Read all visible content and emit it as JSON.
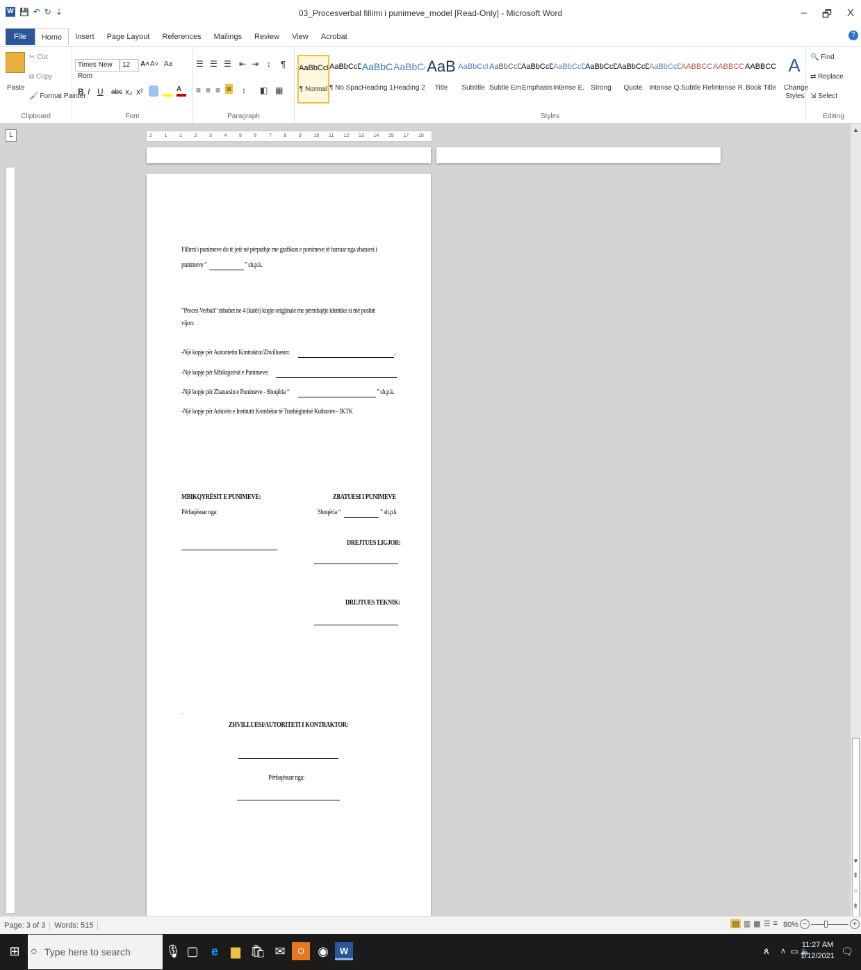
{
  "window": {
    "title": "03_Procesverbal fillimi i punimeve_model [Read-Only] - Microsoft Word",
    "minimize": "–",
    "restore": "🗗",
    "close": "X"
  },
  "qat": {
    "word_icon": "W",
    "save_icon": "💾",
    "undo_icon": "↶",
    "redo_icon": "↻",
    "customize": "⇣"
  },
  "tabs": [
    "File",
    "Home",
    "Insert",
    "Page Layout",
    "References",
    "Mailings",
    "Review",
    "View",
    "Acrobat"
  ],
  "ribbon": {
    "clipboard": {
      "paste": "Paste",
      "cut": "Cut",
      "copy": "Copy",
      "format_painter": "Format Painter",
      "label": "Clipboard"
    },
    "font": {
      "name": "Times New Rom",
      "size": "12",
      "label": "Font",
      "bold": "B",
      "italic": "I",
      "underline": "U",
      "strike": "abc",
      "sub": "x₂",
      "sup": "x²",
      "grow": "A˄",
      "shrink": "A˅",
      "case": "Aa"
    },
    "paragraph": {
      "label": "Paragraph",
      "pilcrow": "¶"
    },
    "styles": {
      "label": "Styles",
      "items": [
        {
          "sample": "AaBbCcDc",
          "name": "¶ Normal",
          "color": "#000000"
        },
        {
          "sample": "AaBbCcDc",
          "name": "¶ No Spaci...",
          "color": "#000000"
        },
        {
          "sample": "AaBbC",
          "name": "Heading 1",
          "color": "#2e74b5"
        },
        {
          "sample": "AaBbCc",
          "name": "Heading 2",
          "color": "#4f81bd"
        },
        {
          "sample": "AaB",
          "name": "Title",
          "color": "#17365d"
        },
        {
          "sample": "AaBbCcI",
          "name": "Subtitle",
          "color": "#4f81bd"
        },
        {
          "sample": "AaBbCcDc",
          "name": "Subtle Em...",
          "color": "#555555"
        },
        {
          "sample": "AaBbCcDc",
          "name": "Emphasis",
          "color": "#000000"
        },
        {
          "sample": "AaBbCcDc",
          "name": "Intense E...",
          "color": "#4f81bd"
        },
        {
          "sample": "AaBbCcDc",
          "name": "Strong",
          "color": "#000000"
        },
        {
          "sample": "AaBbCcDc",
          "name": "Quote",
          "color": "#000000"
        },
        {
          "sample": "AaBbCcDc",
          "name": "Intense Q...",
          "color": "#4f81bd"
        },
        {
          "sample": "AABBCCDC",
          "name": "Subtle Ref...",
          "color": "#c0504d"
        },
        {
          "sample": "AABBCCDC",
          "name": "Intense R...",
          "color": "#c0504d"
        },
        {
          "sample": "AABBCCDC",
          "name": "Book Title",
          "color": "#000000"
        }
      ],
      "change_styles": "Change Styles"
    },
    "editing": {
      "find": "Find",
      "replace": "Replace",
      "select": "Select",
      "label": "Editing"
    }
  },
  "document": {
    "para1_line1": "Fillimi i punimeve do të jetë në përputhje me grafikun e punimeve të hartuar nga zbatuesi i",
    "para1_line2_a": "punimeve “",
    "para1_line2_b": "” sh.p.k.",
    "para2_line1": "“Proces Verbali” mbahet ne 4 (katër) kopje origjinale me përmbajtje identike si më poshtë",
    "para2_line2": "vijon:",
    "copy1": "-Një kopje për Autoritetin Kontraktor/Zhvilluesin:",
    "copy1_end": ",",
    "copy2": "-Një kopje për Mbikqyrësit e Punimeve:",
    "copy3": "-Një kopje për Zbatuesin e Punimeve - Shoqëria “",
    "copy3_end": "” sh.p.k.",
    "copy4": "-Një kopje për Arkivën e Institutit Kombëtar të Trashëgimisë Kulturore - IKTK",
    "left_heading": "MBIKQYRËSIT E PUNIMEVE:",
    "left_sub": "Përfaqësuar nga:",
    "right_heading": "ZBATUESI I PUNIMEVE",
    "right_sub_a": "Shoqëria “",
    "right_sub_b": "” sh.p.k",
    "drejtues_ligjor": "DREJTUES LIGJOR:",
    "drejtues_teknik": "DREJTUES TEKNIK:",
    "dot": ".",
    "zhvilluesi": "ZHVILLUESI/AUTORITETI I KONTRAKTOR:",
    "perfaqesuar": "Përfaqësuar nga:"
  },
  "ruler": {
    "corner": "L",
    "h_marks": [
      "2",
      "1",
      "1",
      "2",
      "3",
      "4",
      "5",
      "6",
      "7",
      "8",
      "9",
      "10",
      "11",
      "12",
      "13",
      "14",
      "15",
      "17",
      "18"
    ]
  },
  "status": {
    "page": "Page: 3 of 3",
    "words": "Words: 515",
    "zoom": "80%",
    "zoom_minus": "−",
    "zoom_plus": "+",
    "zoom_level": 0.4
  },
  "taskbar": {
    "search_placeholder": "Type here to search",
    "time": "11:27 AM",
    "date": "1/12/2021"
  }
}
